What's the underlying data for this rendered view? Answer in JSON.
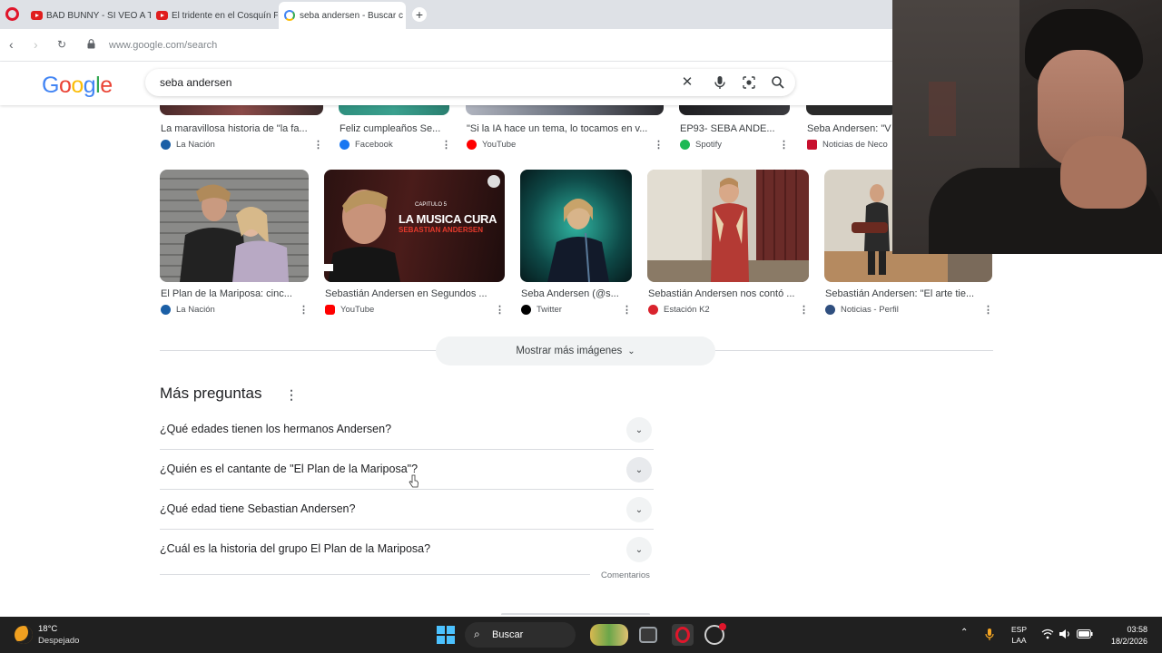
{
  "browser": {
    "tabs": [
      {
        "label": "BAD BUNNY - SI VEO A TU"
      },
      {
        "label": "El tridente en el Cosquín F"
      },
      {
        "label": "seba andersen - Buscar c"
      }
    ],
    "url": "www.google.com/search"
  },
  "google": {
    "logo": "Google",
    "query": "seba andersen"
  },
  "image_row_top": [
    {
      "title": "La maravillosa historia de \"la fa...",
      "source": "La Nación",
      "fav_color": "#1b5fa6"
    },
    {
      "title": "Feliz cumpleaños Se...",
      "source": "Facebook",
      "fav_color": "#1877f2"
    },
    {
      "title": "\"Si la IA hace un tema, lo tocamos en v...",
      "source": "YouTube",
      "fav_color": "#ff0000"
    },
    {
      "title": "EP93- SEBA ANDE...",
      "source": "Spotify",
      "fav_color": "#1db954"
    },
    {
      "title": "Seba Andersen: \"V",
      "source": "Noticias de Neco",
      "fav_color": "#c8102e"
    }
  ],
  "image_row_main": [
    {
      "title": "El Plan de la Mariposa: cinc...",
      "source": "La Nación",
      "fav_color": "#1b5fa6"
    },
    {
      "title": "Sebastián Andersen en Segundos ...",
      "source": "YouTube",
      "fav_color": "#ff0000",
      "overlay_small": "CAPITULO 5",
      "overlay_big": "LA MUSICA CURA",
      "overlay_name": "SEBASTIAN ANDERSEN"
    },
    {
      "title": "Seba Andersen (@s...",
      "source": "Twitter",
      "fav_color": "#000000"
    },
    {
      "title": "Sebastián Andersen nos contó ...",
      "source": "Estación K2",
      "fav_color": "#d9232d"
    },
    {
      "title": "Sebastián Andersen: \"El arte tie...",
      "source": "Noticias - Perfil",
      "fav_color": "#2f4f7f"
    }
  ],
  "show_more_images": "Mostrar más imágenes",
  "paa": {
    "title": "Más preguntas",
    "questions": [
      "¿Qué edades tienen los hermanos Andersen?",
      "¿Quién es el cantante de \"El Plan de la Mariposa\"?",
      "¿Qué edad tiene Sebastian Andersen?",
      "¿Cuál es la historia del grupo El Plan de la Mariposa?"
    ],
    "feedback": "Comentarios"
  },
  "taskbar": {
    "temperature": "18°C",
    "weather": "Despejado",
    "search_label": "Buscar",
    "lang_top": "ESP",
    "lang_bottom": "LAA",
    "time": "03:58",
    "date": "18/2/2026"
  }
}
